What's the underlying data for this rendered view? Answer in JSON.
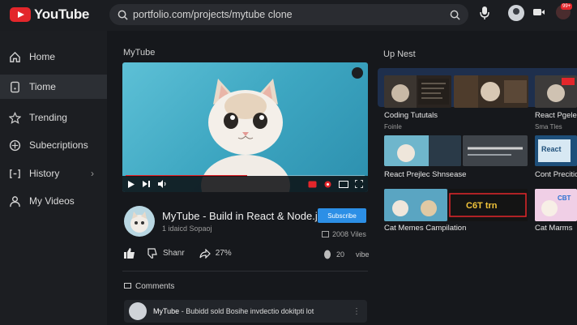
{
  "header": {
    "logo_text": "YouTube",
    "search_value": "portfolio.com/projects/mytube clone",
    "notif_badge": "99+"
  },
  "sidebar": {
    "items": [
      {
        "label": "Home",
        "icon": "home-icon"
      },
      {
        "label": "Tiome",
        "icon": "phone-icon",
        "active": true
      },
      {
        "label": "Trending",
        "icon": "star-icon"
      },
      {
        "label": "Subecriptions",
        "icon": "subscriptions-icon"
      },
      {
        "label": "History",
        "icon": "history-icon"
      },
      {
        "label": "My Videos",
        "icon": "user-videos-icon"
      }
    ]
  },
  "main": {
    "section_title": "MyTube",
    "video": {
      "title": "MyTube - Build in React & Node.js",
      "subtitle": "1 idaicd Sopaoj",
      "subscribe_label": "Subscribe",
      "views": "2008 Viles",
      "progress": 0.51,
      "share_label": "Shanr",
      "like_count": "27%",
      "vibe_count": "20",
      "vibe_label": "vibe"
    },
    "comments": {
      "heading": "Comments",
      "items": [
        {
          "author": "MyTube",
          "text": "- Bubidd sold Bosihe invdectio dokitpti lot"
        }
      ]
    }
  },
  "upnext": {
    "heading": "Up Nest",
    "rows": [
      {
        "label_left": "Coding Tututals",
        "sub_left": "Foinle",
        "label_right": "React Pgelect",
        "sub_right": "Sma Tles"
      },
      {
        "label_left": "React Prejlec Shnsease",
        "sub_left": "",
        "label_right": "Cont Precition",
        "sub_right": ""
      },
      {
        "label_left": "Cat Memes Campilation",
        "sub_left": "",
        "label_right": "Cat Marms",
        "sub_right": ""
      }
    ],
    "thumb_texts": [
      "C6T trn",
      "C6T",
      "React",
      "CBT"
    ]
  }
}
